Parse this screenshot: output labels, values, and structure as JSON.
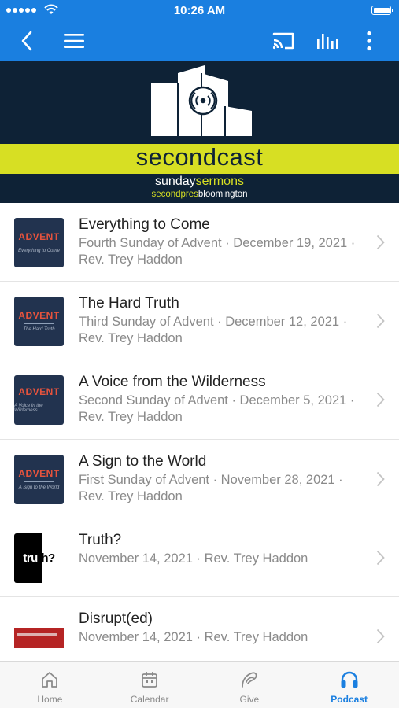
{
  "status_bar": {
    "time": "10:26 AM"
  },
  "banner": {
    "title": "secondcast",
    "subtitle_a": "sunday",
    "subtitle_b": "sermons",
    "tagline_a": "secondpres",
    "tagline_b": "bloomington"
  },
  "episodes": [
    {
      "title": "Everything to Come",
      "meta": "Fourth Sunday of Advent · December 19, 2021 · Rev. Trey Haddon",
      "thumb_label": "ADVENT",
      "thumb_script": "Everything to Come"
    },
    {
      "title": "The Hard Truth",
      "meta": "Third Sunday of Advent · December 12, 2021 · Rev. Trey Haddon",
      "thumb_label": "ADVENT",
      "thumb_script": "The Hard Truth"
    },
    {
      "title": "A Voice from the Wilderness",
      "meta": "Second Sunday of Advent · December 5, 2021 · Rev. Trey Haddon",
      "thumb_label": "ADVENT",
      "thumb_script": "A Voice in the Wilderness"
    },
    {
      "title": "A Sign to the World",
      "meta": "First Sunday of Advent · November 28, 2021 · Rev. Trey Haddon",
      "thumb_label": "ADVENT",
      "thumb_script": "A Sign to the World"
    },
    {
      "title": "Truth?",
      "meta": "November 14, 2021 · Rev. Trey Haddon",
      "thumb_word_a": "tru",
      "thumb_word_b": "th?"
    },
    {
      "title": "Disrupt(ed)",
      "meta": "November 14, 2021 · Rev. Trey Haddon"
    }
  ],
  "tabs": [
    {
      "label": "Home",
      "icon": "home-icon"
    },
    {
      "label": "Calendar",
      "icon": "calendar-icon"
    },
    {
      "label": "Give",
      "icon": "give-icon"
    },
    {
      "label": "Podcast",
      "icon": "headphones-icon",
      "active": true
    }
  ],
  "colors": {
    "app_bar": "#1a7fe0",
    "banner_bg": "#0e2236",
    "banner_accent": "#d7df23",
    "thumb_advent": "#22334f",
    "advent_red": "#e5533d"
  }
}
